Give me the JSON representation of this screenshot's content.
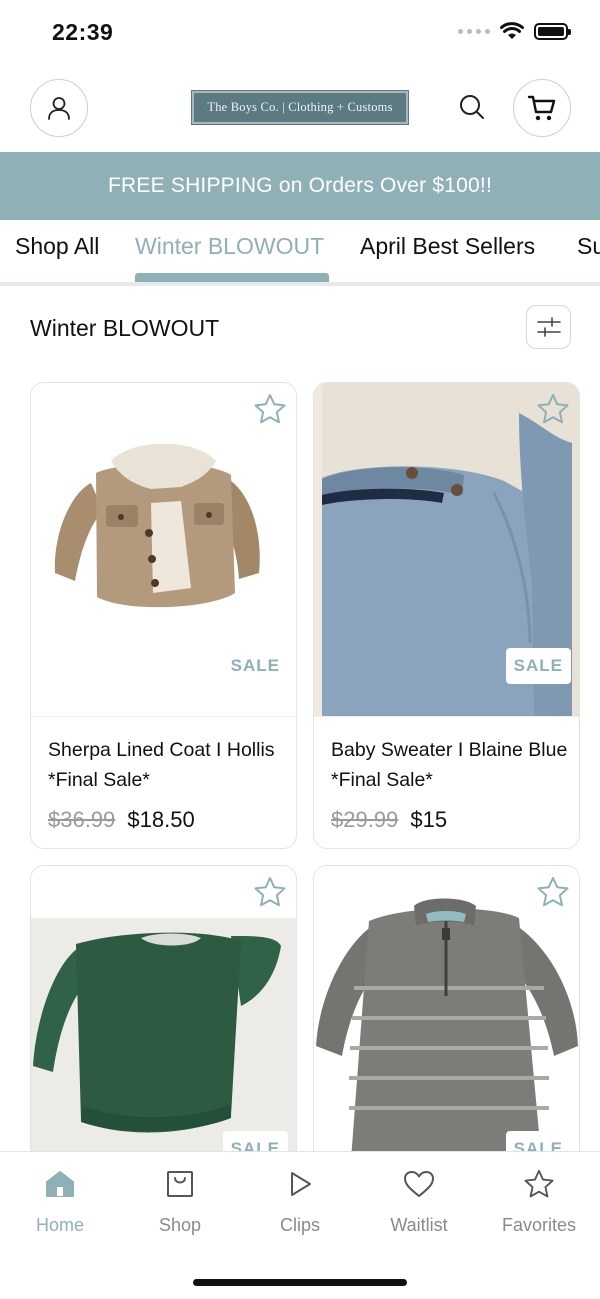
{
  "status_bar": {
    "time": "22:39"
  },
  "header": {
    "logo_text": "The Boys Co. | Clothing + Customs",
    "icons": [
      "account-icon",
      "search-icon",
      "cart-icon"
    ]
  },
  "banner": {
    "text": "FREE SHIPPING on Orders Over $100!!"
  },
  "tabs": [
    {
      "label": "Shop All"
    },
    {
      "label": "Winter BLOWOUT",
      "active": true
    },
    {
      "label": "April Best Sellers"
    },
    {
      "label": "Su"
    }
  ],
  "section": {
    "title": "Winter BLOWOUT"
  },
  "products": [
    {
      "name": "Sherpa Lined Coat I Hollis *Final Sale*",
      "old_price": "$36.99",
      "price": "$18.50",
      "badge": "SALE",
      "image": "tan corduroy sherpa jacket"
    },
    {
      "name": "Baby Sweater I Blaine Blue *Final Sale*",
      "old_price": "$29.99",
      "price": "$15",
      "badge": "SALE",
      "image": "light blue knit sweater"
    },
    {
      "name": "",
      "old_price": "",
      "price": "",
      "badge": "SALE",
      "image": "green sweatshirt"
    },
    {
      "name": "",
      "old_price": "",
      "price": "",
      "badge": "SALE",
      "image": "gray striped quarter-zip pullover"
    }
  ],
  "bottom_nav": [
    {
      "label": "Home",
      "icon": "home-icon",
      "active": true
    },
    {
      "label": "Shop",
      "icon": "shopping-bag-icon"
    },
    {
      "label": "Clips",
      "icon": "play-icon"
    },
    {
      "label": "Waitlist",
      "icon": "heart-icon"
    },
    {
      "label": "Favorites",
      "icon": "star-icon"
    }
  ],
  "colors": {
    "accent": "#8fb0b7",
    "logo_bg": "#5b7a82",
    "sale": "#8fb0b7"
  }
}
